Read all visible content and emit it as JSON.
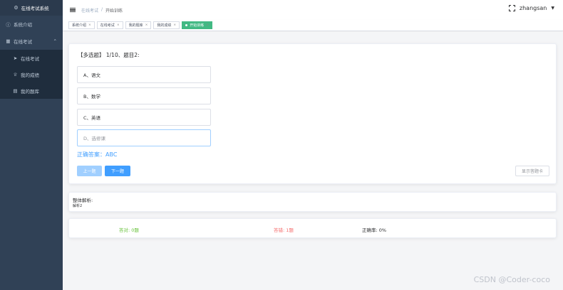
{
  "sidebar": {
    "title": "在线考试系统",
    "items": [
      {
        "label": "系统介绍",
        "icon": "info-icon"
      },
      {
        "label": "在线考试",
        "icon": "grid-icon"
      }
    ],
    "subitems": [
      {
        "label": "在线考试",
        "icon": "send-icon"
      },
      {
        "label": "我的成绩",
        "icon": "trophy-icon"
      },
      {
        "label": "我的题库",
        "icon": "book-icon"
      }
    ]
  },
  "header": {
    "breadcrumb": [
      "在线考试",
      "开始训练"
    ],
    "username": "zhangsan"
  },
  "tags": [
    {
      "label": "系统介绍"
    },
    {
      "label": "在线考试"
    },
    {
      "label": "我的题库"
    },
    {
      "label": "我的成绩"
    },
    {
      "label": "开始训练",
      "active": true
    }
  ],
  "question": {
    "title": "【多选题】 1/10、题目2:",
    "options": [
      "A、语文",
      "B、数学",
      "C、英语",
      "D、选修课"
    ],
    "answer": "正确答案：ABC",
    "prev_label": "上一题",
    "next_label": "下一题",
    "card_label": "显示答题卡"
  },
  "analysis": {
    "title": "整体解析:",
    "body": "解析2"
  },
  "stats": {
    "right": "答对: 0题",
    "wrong": "答错: 1题",
    "rate": "正确率: 0%"
  },
  "watermark": "CSDN @Coder-coco",
  "colors": {
    "sidebar": "#304156",
    "primary": "#409eff",
    "success": "#67c23a",
    "danger": "#f56c6c",
    "active_tag": "#42b983"
  }
}
